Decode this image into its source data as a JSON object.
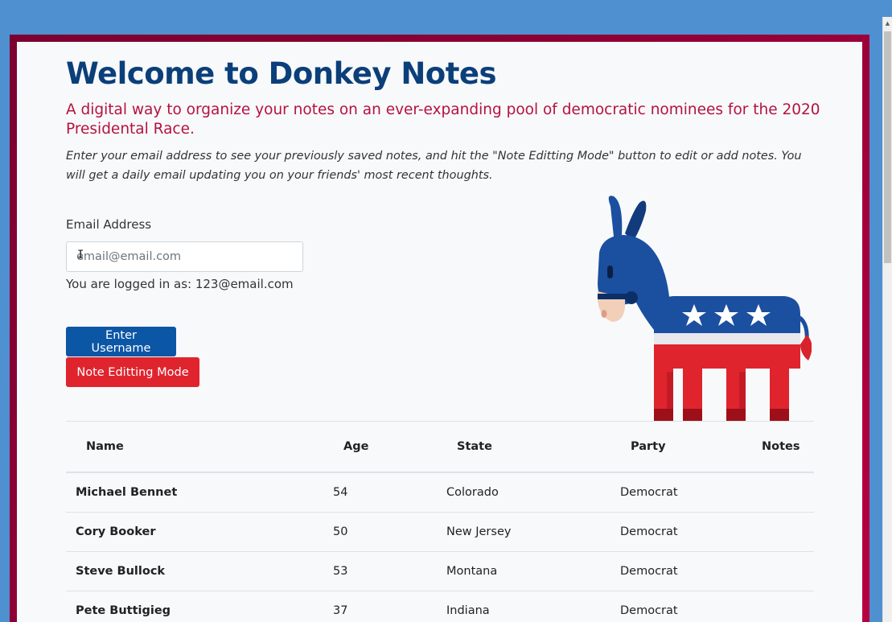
{
  "header": {
    "title": "Welcome to Donkey Notes",
    "subtitle": "A digital way to organize your notes on an ever-expanding pool of democratic nominees for the 2020 Presidental Race.",
    "lead": "Enter your email address to see your previously saved notes, and hit the \"Note Editting Mode\" button to edit or add notes. You will get a daily email updating you on your friends' most recent thoughts."
  },
  "form": {
    "email_label": "Email Address",
    "email_placeholder": "email@email.com",
    "email_value": "",
    "logged_in_text": "You are logged in as: 123@email.com",
    "enter_button": "Enter Username",
    "edit_button": "Note Editting Mode"
  },
  "icons": {
    "mascot": "democratic-donkey-icon",
    "text_cursor": "i-beam-cursor-icon"
  },
  "colors": {
    "title": "#0b3f7a",
    "subtitle": "#b5123f",
    "primary_button": "#0c56a6",
    "danger_button": "#e0242e",
    "frame": "#8e0035",
    "background": "#4f90d1"
  },
  "table": {
    "headers": [
      "Name",
      "Age",
      "State",
      "Party",
      "Notes"
    ],
    "rows": [
      {
        "name": "Michael Bennet",
        "age": "54",
        "state": "Colorado",
        "party": "Democrat",
        "notes": ""
      },
      {
        "name": "Cory Booker",
        "age": "50",
        "state": "New Jersey",
        "party": "Democrat",
        "notes": ""
      },
      {
        "name": "Steve Bullock",
        "age": "53",
        "state": "Montana",
        "party": "Democrat",
        "notes": ""
      },
      {
        "name": "Pete Buttigieg",
        "age": "37",
        "state": "Indiana",
        "party": "Democrat",
        "notes": ""
      }
    ]
  }
}
